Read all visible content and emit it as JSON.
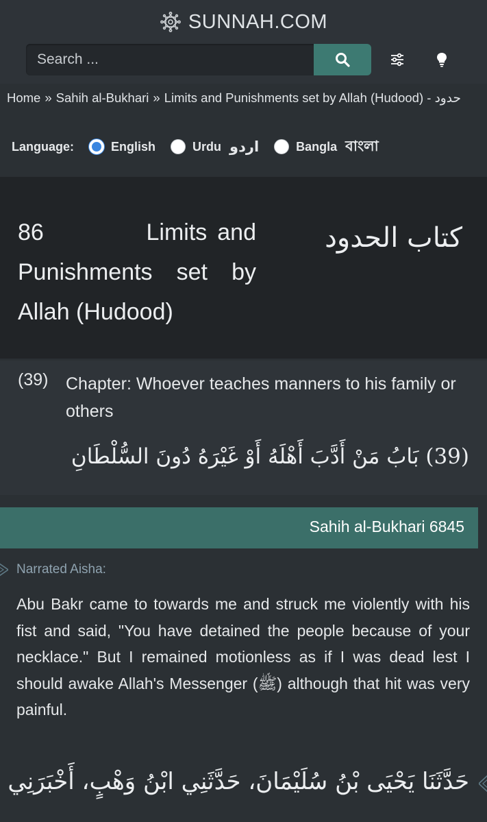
{
  "site": {
    "name": "SUNNAH.COM"
  },
  "search": {
    "placeholder": "Search ...",
    "button_icon": "search-icon"
  },
  "toolbar": {
    "settings_icon": "sliders-icon",
    "theme_icon": "lightbulb-icon"
  },
  "breadcrumb": {
    "items": [
      "Home",
      "Sahih al-Bukhari",
      "Limits and Punishments set by Allah (Hudood) - حدود"
    ],
    "separator": "»"
  },
  "language": {
    "label": "Language:",
    "options": [
      {
        "label": "English",
        "native": "",
        "selected": true
      },
      {
        "label": "Urdu",
        "native": "اردو",
        "selected": false
      },
      {
        "label": "Bangla",
        "native": "বাংলা",
        "selected": false
      }
    ]
  },
  "book": {
    "number": "86",
    "title_en": "Limits and Punishments set by Allah (Hudood)",
    "title_ar": "كتاب الحدود"
  },
  "chapter": {
    "number": "(39)",
    "title_en": "Chapter: Whoever teaches manners to his family or others",
    "number_ar": "(39)",
    "title_ar": "بَابُ مَنْ أَدَّبَ أَهْلَهُ أَوْ غَيْرَهُ دُونَ السُّلْطَانِ"
  },
  "hadith": {
    "reference": "Sahih al-Bukhari 6845",
    "narrator": "Narrated Aisha:",
    "text_en": "Abu Bakr came to towards me and struck me violently with his fist and said, \"You have detained the people because of your necklace.\" But I remained motionless as if I was dead lest I should awake Allah's Messenger (ﷺ) although that hit was very painful.",
    "text_ar_start": "حَدَّثَنَا يَحْيَى بْنُ سُلَيْمَانَ، حَدَّثَنِي ابْنُ وَهْبٍ، أَخْبَرَنِي"
  },
  "colors": {
    "background": "#2b3034",
    "accent": "#3d7a72",
    "reference_bar": "#3b6f69",
    "book_header_bg": "#212427",
    "radio_selected": "#3a86e0",
    "narrator_text": "#8fa3b0"
  }
}
